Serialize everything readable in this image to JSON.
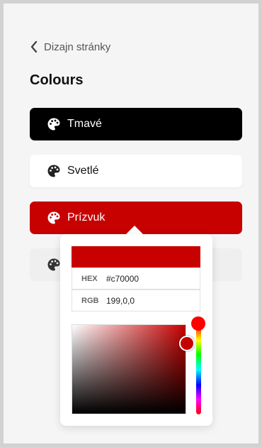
{
  "header": {
    "back_label": "Dizajn stránky"
  },
  "page": {
    "title": "Colours"
  },
  "options": [
    {
      "label": "Tmavé"
    },
    {
      "label": "Svetlé"
    },
    {
      "label": "Prízvuk"
    },
    {
      "label": ""
    }
  ],
  "picker": {
    "hex_label": "HEX",
    "hex_value": "#c70000",
    "rgb_label": "RGB",
    "rgb_value": "199,0,0",
    "selected_color": "#c70000",
    "hue_color": "#ff0000"
  },
  "colors": {
    "dark": "#000000",
    "accent": "#c70000"
  }
}
